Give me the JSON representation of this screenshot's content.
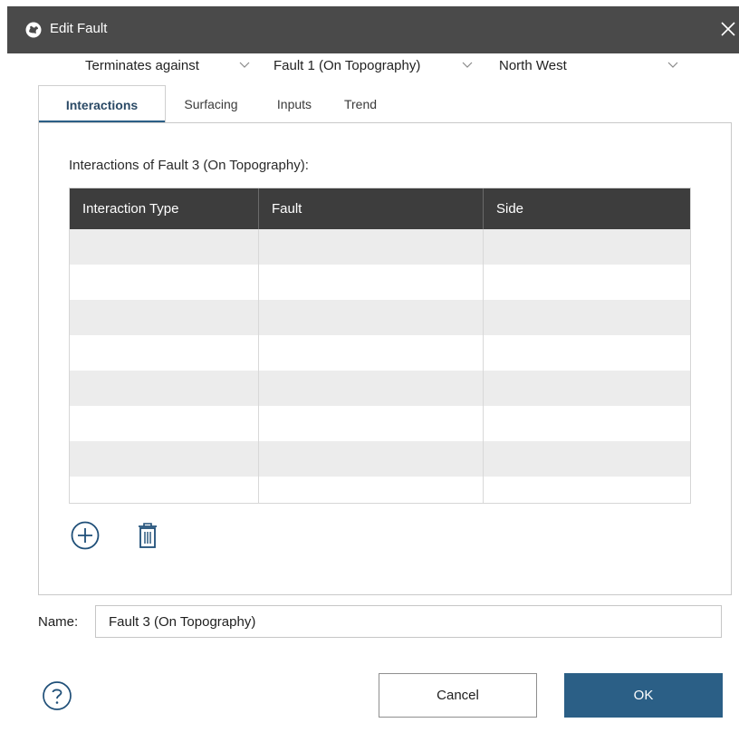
{
  "window": {
    "title": "Edit Fault",
    "app_icon": "leapfrog-icon",
    "close_icon": "close-icon"
  },
  "tabs": [
    {
      "label": "Interactions",
      "active": true
    },
    {
      "label": "Surfacing",
      "active": false
    },
    {
      "label": "Inputs",
      "active": false
    },
    {
      "label": "Trend",
      "active": false
    }
  ],
  "interactions": {
    "label": "Interactions of Fault 3 (On Topography):",
    "columns": [
      "Interaction Type",
      "Fault",
      "Side"
    ],
    "rows": [
      {
        "interaction_type": "Terminates against",
        "fault": "Fault 1 (On Topography)",
        "side": "North West"
      }
    ],
    "add_icon": "plus-circle-icon",
    "delete_icon": "trash-icon"
  },
  "name": {
    "label": "Name:",
    "value": "Fault 3 (On Topography)"
  },
  "buttons": {
    "help_icon": "question-circle-icon",
    "cancel": "Cancel",
    "ok": "OK"
  },
  "colors": {
    "accent": "#2b5f86",
    "titlebar": "#4a4a4a",
    "grid_header": "#3d3d3d"
  }
}
